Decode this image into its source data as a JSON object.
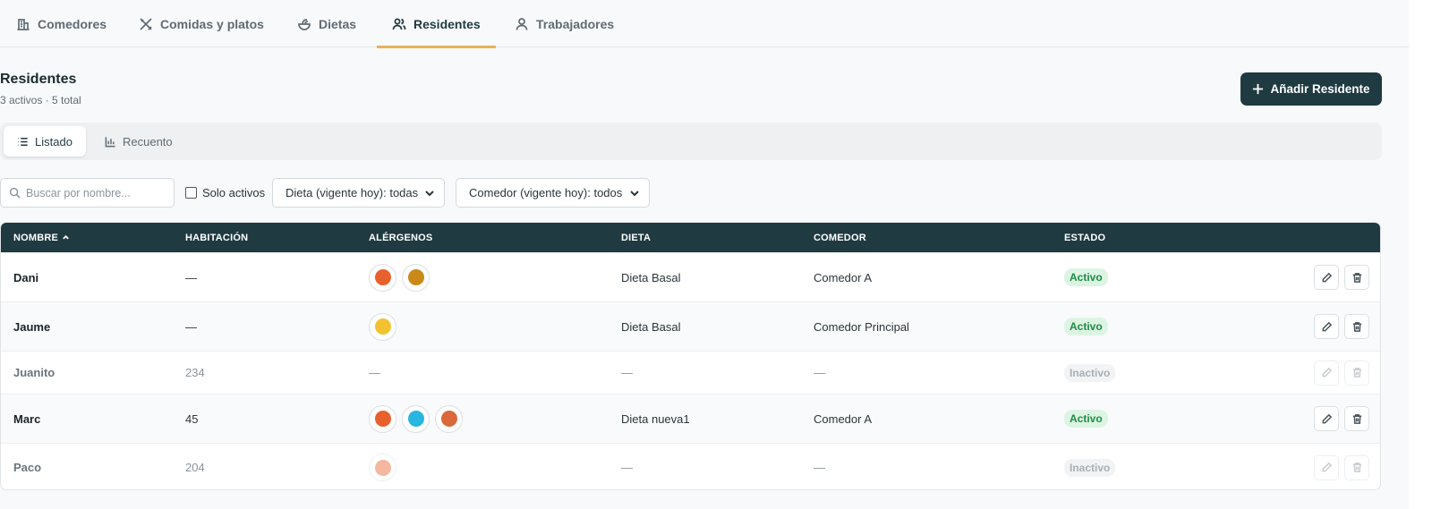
{
  "nav": {
    "tabs": [
      {
        "label": "Comedores",
        "icon": "building-icon"
      },
      {
        "label": "Comidas y platos",
        "icon": "utensils-icon"
      },
      {
        "label": "Dietas",
        "icon": "salad-icon"
      },
      {
        "label": "Residentes",
        "icon": "users-icon",
        "active": true
      },
      {
        "label": "Trabajadores",
        "icon": "user-icon"
      }
    ]
  },
  "header": {
    "title": "Residentes",
    "subtitle": "3 activos · 5 total",
    "add_button": "Añadir Residente"
  },
  "views": {
    "list": "Listado",
    "count": "Recuento"
  },
  "filters": {
    "search_placeholder": "Buscar por nombre...",
    "only_active_label": "Solo activos",
    "only_active_checked": false,
    "diet_select": "Dieta (vigente hoy): todas",
    "dining_select": "Comedor (vigente hoy): todos"
  },
  "table": {
    "columns": [
      "NOMBRE",
      "HABITACIÓN",
      "ALÉRGENOS",
      "DIETA",
      "COMEDOR",
      "ESTADO"
    ],
    "sort_column": "NOMBRE",
    "sort_direction": "asc",
    "rows": [
      {
        "name": "Dani",
        "room": "—",
        "allergens": [
          "#e8612c",
          "#c98a1a"
        ],
        "diet": "Dieta Basal",
        "dining": "Comedor A",
        "status": "Activo"
      },
      {
        "name": "Jaume",
        "room": "—",
        "allergens": [
          "#f2c230"
        ],
        "diet": "Dieta Basal",
        "dining": "Comedor Principal",
        "status": "Activo"
      },
      {
        "name": "Juanito",
        "room": "234",
        "allergens_text": "—",
        "allergens": [],
        "diet": "—",
        "dining": "—",
        "status": "Inactivo"
      },
      {
        "name": "Marc",
        "room": "45",
        "allergens": [
          "#e8612c",
          "#29b6e0",
          "#d9683a"
        ],
        "diet": "Dieta nueva1",
        "dining": "Comedor A",
        "status": "Activo"
      },
      {
        "name": "Paco",
        "room": "204",
        "allergens": [
          "#e8612c"
        ],
        "diet": "—",
        "dining": "—",
        "status": "Inactivo"
      }
    ]
  },
  "colors": {
    "primary": "#1f3a40",
    "accent": "#e8b15a",
    "active_badge": "#1f8a45"
  }
}
